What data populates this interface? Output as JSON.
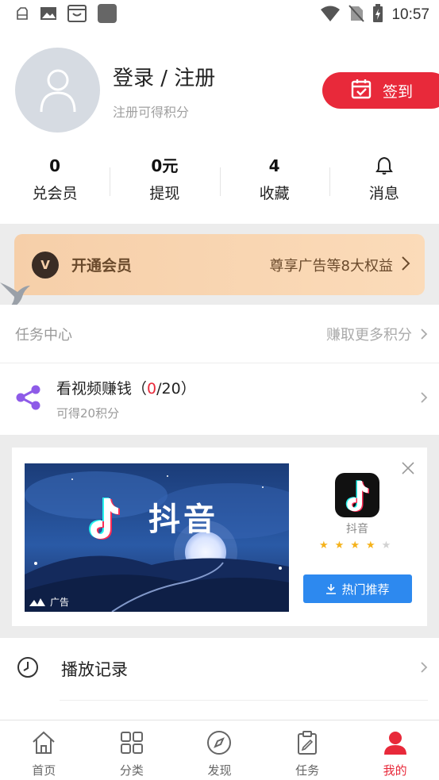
{
  "status_bar": {
    "time": "10:57"
  },
  "profile": {
    "title": "登录 / 注册",
    "subtitle": "注册可得积分",
    "signin_label": "签到"
  },
  "stats": [
    {
      "value": "0",
      "label": "兑会员"
    },
    {
      "value": "0元",
      "label": "提现"
    },
    {
      "value": "4",
      "label": "收藏"
    },
    {
      "value": "",
      "label": "消息",
      "icon": "bell-icon"
    }
  ],
  "vip": {
    "badge": "V",
    "title": "开通会员",
    "desc": "尊享广告等8大权益"
  },
  "task_center": {
    "title": "任务中心",
    "more": "赚取更多积分",
    "item": {
      "name_prefix": "看视频赚钱（",
      "done": "0",
      "name_suffix": "/20）",
      "reward": "可得20积分"
    }
  },
  "ad": {
    "banner_text": "抖音",
    "mark": "广告",
    "app_name": "抖音",
    "rating": 4,
    "rating_max": 5,
    "button_label": "热门推荐"
  },
  "history": {
    "label": "播放记录"
  },
  "tabbar": [
    {
      "label": "首页",
      "icon": "home-icon",
      "active": false
    },
    {
      "label": "分类",
      "icon": "grid-icon",
      "active": false
    },
    {
      "label": "发现",
      "icon": "compass-icon",
      "active": false
    },
    {
      "label": "任务",
      "icon": "clipboard-icon",
      "active": false
    },
    {
      "label": "我的",
      "icon": "user-icon",
      "active": true
    }
  ],
  "colors": {
    "accent": "#e8293a",
    "vip_gold": "#f6cfa9",
    "ad_button": "#2d89ef"
  }
}
